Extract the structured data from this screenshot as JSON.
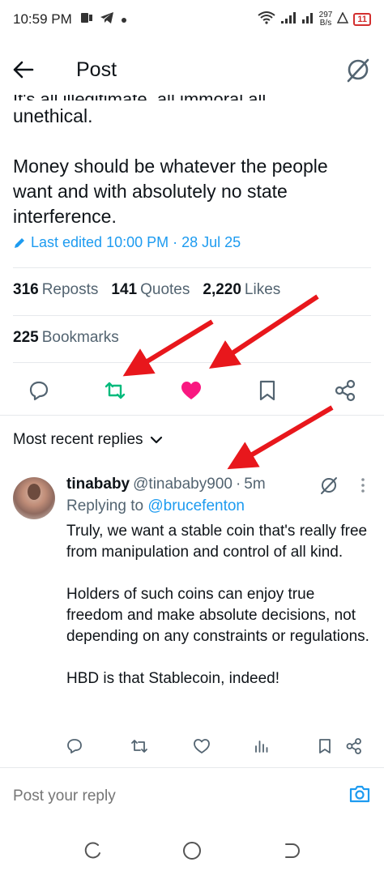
{
  "status_bar": {
    "time": "10:59 PM",
    "speed_value": "297",
    "speed_unit": "B/s",
    "battery": "11"
  },
  "header": {
    "title": "Post"
  },
  "post": {
    "cut_text": "It's all illegitimate, all immoral all",
    "paragraphs": [
      "unethical.",
      "Money should be whatever the people want and with absolutely no state interference."
    ],
    "edited": "Last edited 10:00 PM · 28 Jul 25",
    "stats": {
      "reposts_count": "316",
      "reposts_label": "Reposts",
      "quotes_count": "141",
      "quotes_label": "Quotes",
      "likes_count": "2,220",
      "likes_label": "Likes",
      "bookmarks_count": "225",
      "bookmarks_label": "Bookmarks"
    },
    "liked": true
  },
  "replies_sort": "Most recent replies",
  "reply": {
    "name": "tinababy",
    "handle": "@tinababy900",
    "time": "5m",
    "replying_prefix": "Replying to",
    "replying_to": "@brucefenton",
    "paragraphs": [
      "Truly, we want a stable coin that's really free from manipulation and control of all kind.",
      "Holders of such coins can enjoy true freedom and make absolute decisions, not depending on any constraints or regulations.",
      "HBD is that Stablecoin, indeed!"
    ]
  },
  "compose": {
    "placeholder": "Post your reply"
  },
  "colors": {
    "accent": "#1d9bf0",
    "like": "#f91880",
    "repost": "#00ba7c",
    "annotation_arrow": "#e8171c"
  }
}
